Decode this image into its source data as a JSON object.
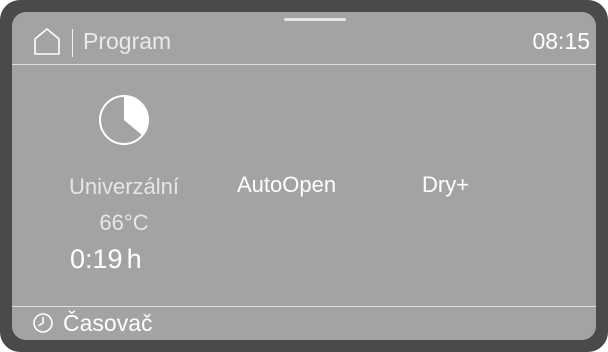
{
  "header": {
    "title": "Program",
    "time": "08:15",
    "home_icon": "home-icon"
  },
  "program": {
    "icon": "pie-chart-icon",
    "name": "Univerzální",
    "temperature": "66°C",
    "duration_value": "0:19",
    "duration_unit": "h"
  },
  "options": [
    {
      "label": "AutoOpen"
    },
    {
      "label": "Dry+"
    }
  ],
  "footer": {
    "icon": "clock-icon",
    "label": "Časovač"
  },
  "colors": {
    "bezel": "#4a4a4a",
    "screen": "#a3a3a3",
    "text": "#ffffff",
    "dim_text": "#e6e6e6"
  }
}
